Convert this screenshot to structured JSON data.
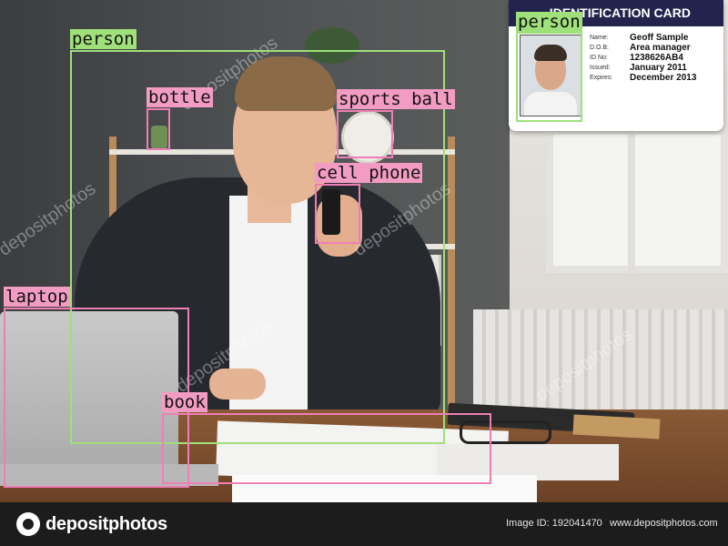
{
  "id_card": {
    "title": "IDENTIFICATION CARD",
    "fields": [
      {
        "label": "Name:",
        "value": "Geoff Sample"
      },
      {
        "label": "D.O.B:",
        "value": "Area manager"
      },
      {
        "label": "ID No:",
        "value": "1238626AB4"
      },
      {
        "label": "Issued:",
        "value": "January 2011"
      },
      {
        "label": "Expires:",
        "value": "December 2013"
      }
    ]
  },
  "detections": [
    {
      "label": "person",
      "color": "#9fe07a"
    },
    {
      "label": "person",
      "color": "#9fe07a"
    },
    {
      "label": "bottle",
      "color": "#ee7fb4"
    },
    {
      "label": "sports ball",
      "color": "#ee7fb4"
    },
    {
      "label": "cell phone",
      "color": "#ee7fb4"
    },
    {
      "label": "laptop",
      "color": "#ee7fb4"
    },
    {
      "label": "book",
      "color": "#ee7fb4"
    }
  ],
  "watermark": {
    "brand": "depositphotos",
    "image_id": "Image ID: 192041470",
    "url": "www.depositphotos.com",
    "overlay_text": "depositphotos"
  }
}
